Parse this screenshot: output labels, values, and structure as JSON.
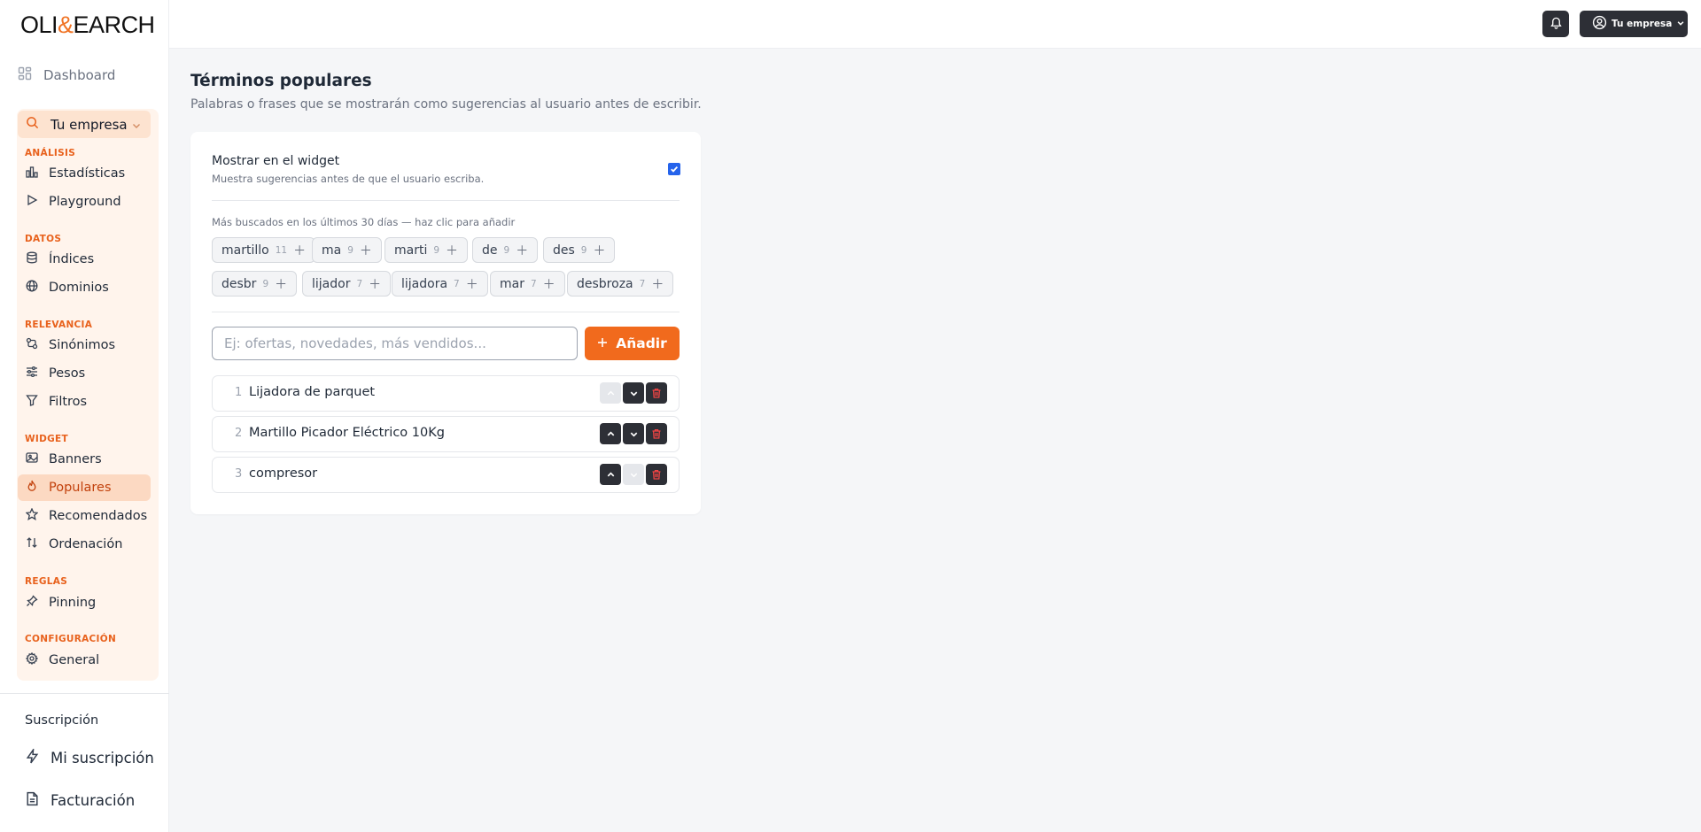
{
  "brand": {
    "logo_pre": "OLI",
    "logo_amp": "&",
    "logo_post": "EARCH",
    "accent": "#f16a1d"
  },
  "sidebar": {
    "dashboard": "Dashboard",
    "company_selector": "Tu empresa",
    "sections": {
      "analysis": "ANÁLISIS",
      "data": "DATOS",
      "relevance": "RELEVANCIA",
      "widget": "WIDGET",
      "rules": "REGLAS",
      "config": "CONFIGURACIÓN"
    },
    "items": {
      "stats": "Estadísticas",
      "playground": "Playground",
      "indices": "Índices",
      "domains": "Dominios",
      "synonyms": "Sinónimos",
      "weights": "Pesos",
      "filters": "Filtros",
      "banners": "Banners",
      "popular": "Populares",
      "recommended": "Recomendados",
      "sorting": "Ordenación",
      "pinning": "Pinning",
      "general": "General"
    },
    "subscription": {
      "title": "Suscripción",
      "my_subscription": "Mi suscripción",
      "billing": "Facturación"
    }
  },
  "topbar": {
    "user_menu": "Tu empresa"
  },
  "page": {
    "title": "Términos populares",
    "subtitle": "Palabras o frases que se mostrarán como sugerencias al usuario antes de escribir."
  },
  "widget_toggle": {
    "title": "Mostrar en el widget",
    "description": "Muestra sugerencias antes de que el usuario escriba.",
    "checked": true
  },
  "suggestions": {
    "hint": "Más buscados en los últimos 30 días — haz clic para añadir",
    "chips": [
      {
        "term": "martillo",
        "count": "11"
      },
      {
        "term": "ma",
        "count": "9"
      },
      {
        "term": "marti",
        "count": "9"
      },
      {
        "term": "de",
        "count": "9"
      },
      {
        "term": "des",
        "count": "9"
      },
      {
        "term": "desbr",
        "count": "9"
      },
      {
        "term": "lijador",
        "count": "7"
      },
      {
        "term": "lijadora",
        "count": "7"
      },
      {
        "term": "mar",
        "count": "7"
      },
      {
        "term": "desbroza",
        "count": "7"
      }
    ]
  },
  "add_form": {
    "placeholder": "Ej: ofertas, novedades, más vendidos...",
    "value": "",
    "button": "Añadir"
  },
  "terms": [
    {
      "position": "1",
      "label": "Lijadora de parquet"
    },
    {
      "position": "2",
      "label": "Martillo Picador Eléctrico 10Kg"
    },
    {
      "position": "3",
      "label": "compresor"
    }
  ]
}
